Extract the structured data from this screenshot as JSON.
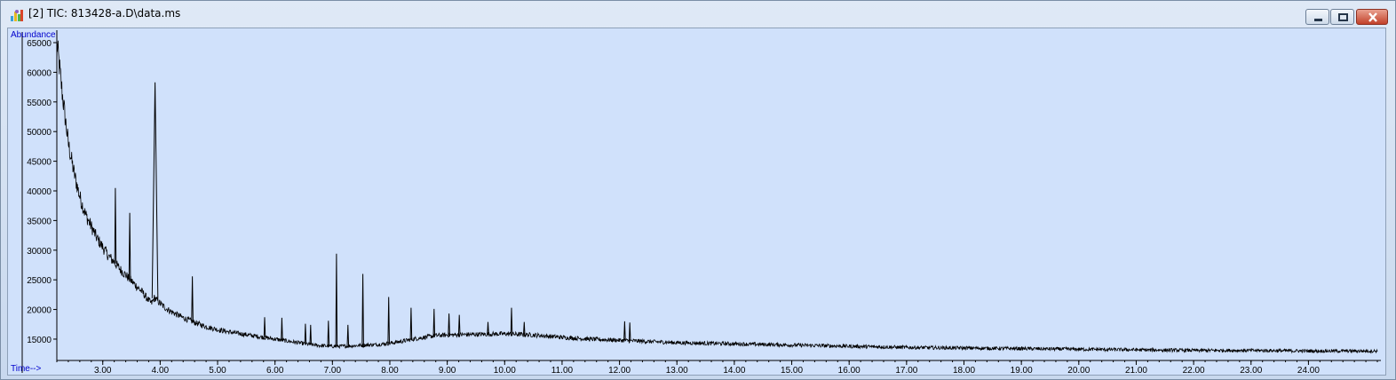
{
  "window": {
    "title": "[2] TIC: 813428-a.D\\data.ms",
    "icon": "chromatogram-icon",
    "controls": [
      "minimize-icon",
      "maximize-icon",
      "close-icon"
    ]
  },
  "colors": {
    "plot_background": "#d0e1fb",
    "trace": "#000000",
    "axis_labels": "#0000cc",
    "close_button": "#c2412a"
  },
  "chart_data": {
    "type": "line",
    "title": "",
    "ylabel": "Abundance",
    "xlabel": "Time-->",
    "xlim": [
      2.2,
      25.2
    ],
    "ylim": [
      12000,
      66500
    ],
    "x_ticks": [
      3.0,
      4.0,
      5.0,
      6.0,
      7.0,
      8.0,
      9.0,
      10.0,
      11.0,
      12.0,
      13.0,
      14.0,
      15.0,
      16.0,
      17.0,
      18.0,
      19.0,
      20.0,
      21.0,
      22.0,
      23.0,
      24.0
    ],
    "x_tick_labels": [
      "3.00",
      "4.00",
      "5.00",
      "6.00",
      "7.00",
      "8.00",
      "9.00",
      "10.00",
      "11.00",
      "12.00",
      "13.00",
      "14.00",
      "15.00",
      "16.00",
      "17.00",
      "18.00",
      "19.00",
      "20.00",
      "21.00",
      "22.00",
      "23.00",
      "24.00"
    ],
    "y_ticks": [
      15000,
      20000,
      25000,
      30000,
      35000,
      40000,
      45000,
      50000,
      55000,
      60000,
      65000
    ],
    "y_tick_labels": [
      "15000",
      "20000",
      "25000",
      "30000",
      "35000",
      "40000",
      "45000",
      "50000",
      "55000",
      "60000",
      "65000"
    ],
    "grid": false,
    "series": [
      {
        "x": [
          2.2,
          2.3,
          2.4,
          2.5,
          2.6,
          2.7,
          2.8,
          2.9,
          3.0,
          3.1,
          3.2,
          3.3,
          3.4,
          3.5,
          3.6,
          3.7,
          3.8,
          3.85,
          3.9,
          3.95,
          4.0,
          4.1,
          4.2,
          4.3,
          4.4,
          4.5,
          4.6,
          4.8,
          5.0,
          5.2,
          5.4,
          5.6,
          5.8,
          6.0,
          6.2,
          6.4,
          6.6,
          6.8,
          7.0,
          7.2,
          7.4,
          7.6,
          7.8,
          8.0,
          8.2,
          8.4,
          8.6,
          8.8,
          9.0,
          9.5,
          10.0,
          10.5,
          11.0,
          11.5,
          12.0,
          12.5,
          13.0,
          13.5,
          14.0,
          15.0,
          16.0,
          17.0,
          18.0,
          19.0,
          20.0,
          21.0,
          22.0,
          23.0,
          24.0,
          25.0,
          25.2
        ],
        "y": [
          65000,
          56000,
          48000,
          43000,
          39000,
          36000,
          34000,
          32000,
          30500,
          29000,
          28000,
          26800,
          25800,
          24800,
          23800,
          22800,
          21500,
          21000,
          22000,
          21500,
          21000,
          20200,
          19600,
          19100,
          18600,
          18200,
          17800,
          17100,
          16600,
          16200,
          15900,
          15600,
          15300,
          15000,
          14700,
          14400,
          14100,
          13900,
          13800,
          13800,
          13900,
          14000,
          14100,
          14300,
          14600,
          15000,
          15300,
          15600,
          15700,
          15800,
          15900,
          15700,
          15300,
          15000,
          14800,
          14600,
          14400,
          14300,
          14200,
          14000,
          13800,
          13600,
          13500,
          13400,
          13300,
          13200,
          13100,
          13100,
          13000,
          13000,
          13000
        ],
        "peaks": [
          {
            "x": 3.22,
            "y": 40500
          },
          {
            "x": 3.47,
            "y": 36300
          },
          {
            "x": 3.91,
            "y": 58300
          },
          {
            "x": 4.56,
            "y": 25600
          },
          {
            "x": 5.82,
            "y": 18700
          },
          {
            "x": 6.12,
            "y": 18600
          },
          {
            "x": 6.53,
            "y": 17600
          },
          {
            "x": 6.62,
            "y": 17400
          },
          {
            "x": 6.93,
            "y": 18100
          },
          {
            "x": 7.07,
            "y": 29400
          },
          {
            "x": 7.27,
            "y": 17400
          },
          {
            "x": 7.53,
            "y": 26000
          },
          {
            "x": 7.98,
            "y": 22100
          },
          {
            "x": 8.37,
            "y": 20300
          },
          {
            "x": 8.77,
            "y": 20100
          },
          {
            "x": 9.03,
            "y": 19300
          },
          {
            "x": 9.21,
            "y": 19100
          },
          {
            "x": 9.71,
            "y": 17900
          },
          {
            "x": 10.12,
            "y": 20300
          },
          {
            "x": 10.34,
            "y": 17900
          },
          {
            "x": 12.09,
            "y": 18000
          },
          {
            "x": 12.18,
            "y": 17800
          }
        ]
      }
    ]
  }
}
